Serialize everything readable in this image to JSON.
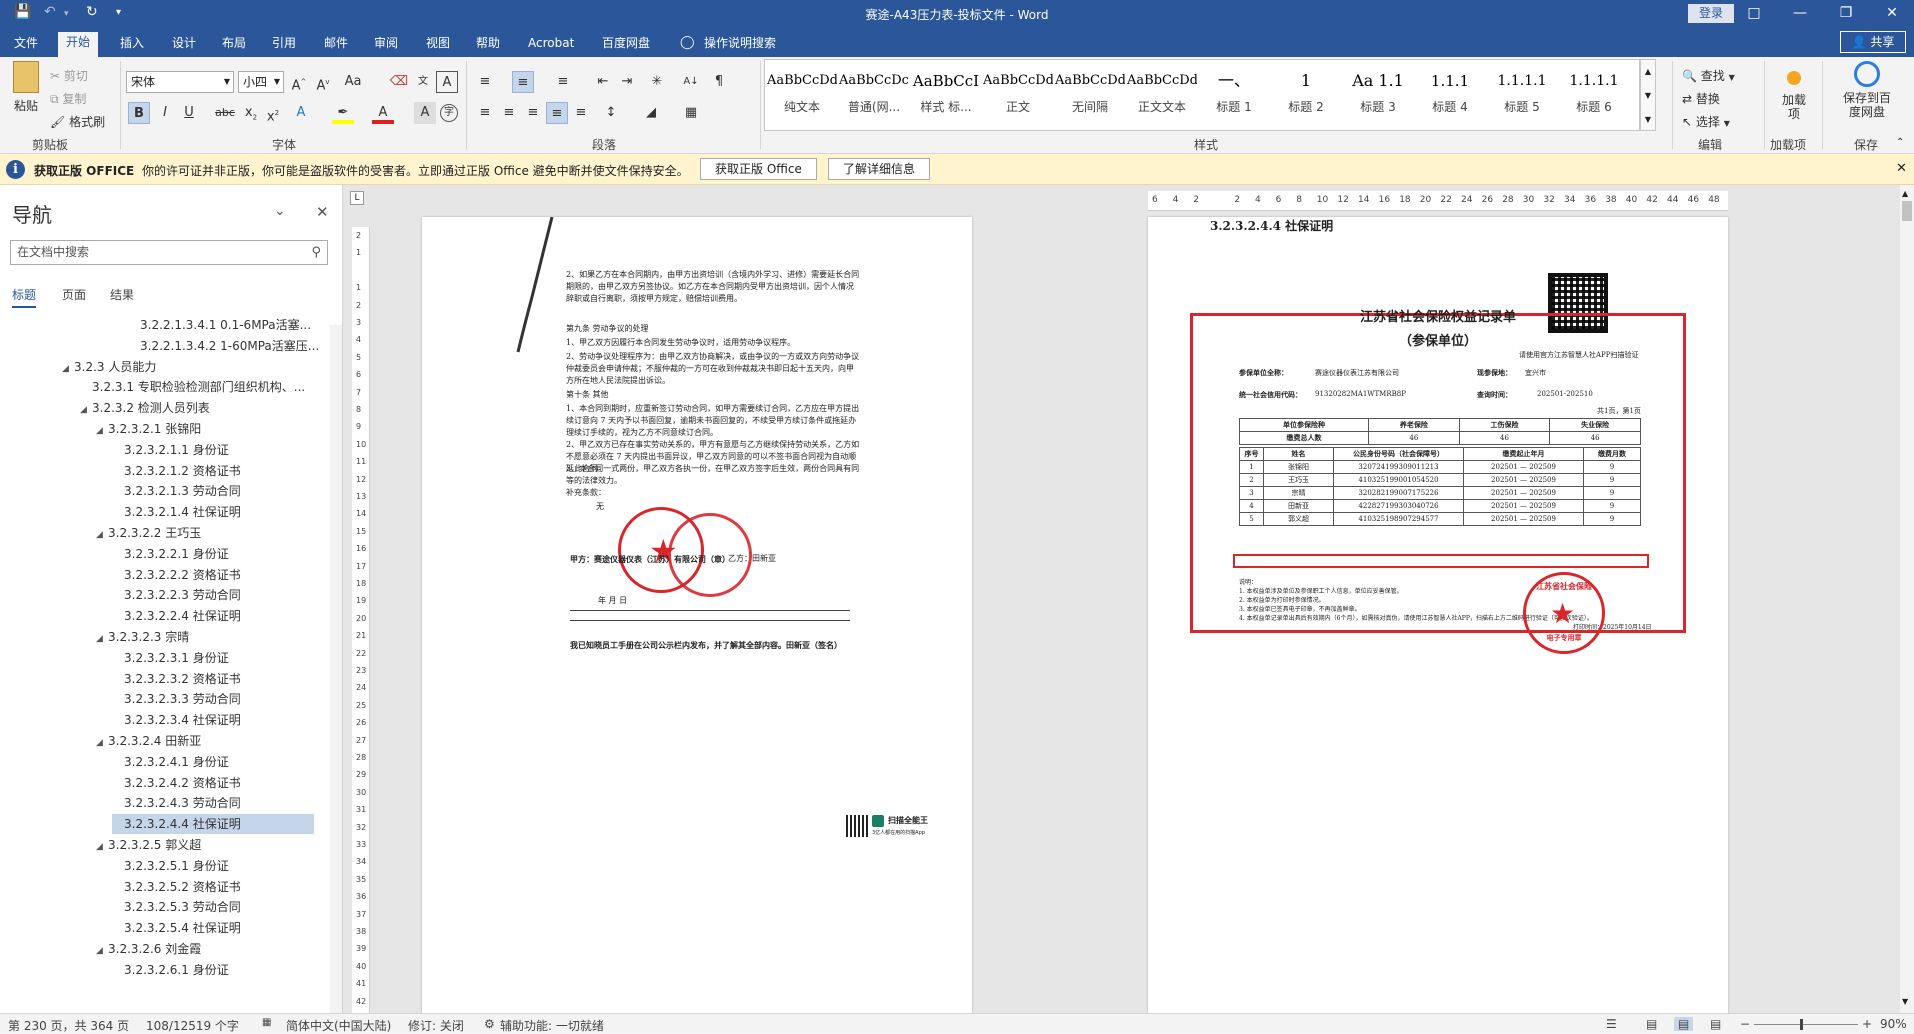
{
  "title_bar": {
    "doc_title": "赛途-A43压力表-投标文件 - Word",
    "login": "登录",
    "share": "共享"
  },
  "tabs": [
    "文件",
    "开始",
    "插入",
    "设计",
    "布局",
    "引用",
    "邮件",
    "审阅",
    "视图",
    "帮助",
    "Acrobat",
    "百度网盘",
    "操作说明搜索"
  ],
  "active_tab": "开始",
  "ribbon": {
    "clipboard": {
      "paste": "粘贴",
      "cut": "剪切",
      "copy": "复制",
      "format_painter": "格式刷",
      "label": "剪贴板"
    },
    "font": {
      "name": "宋体",
      "size": "小四",
      "label": "字体"
    },
    "paragraph": {
      "label": "段落"
    },
    "styles": {
      "label": "样式",
      "items": [
        {
          "preview": "AaBbCcDdI",
          "name": "纯文本"
        },
        {
          "preview": "AaBbCcDc",
          "name": "普通(网..."
        },
        {
          "preview": "AaBbCcI",
          "name": "样式 标..."
        },
        {
          "preview": "AaBbCcDdI",
          "name": "正文"
        },
        {
          "preview": "AaBbCcDdI",
          "name": "无间隔"
        },
        {
          "preview": "AaBbCcDdI",
          "name": "正文文本"
        },
        {
          "preview": "一、",
          "name": "标题 1"
        },
        {
          "preview": "1",
          "name": "标题 2"
        },
        {
          "preview": "Aa 1.1",
          "name": "标题 3"
        },
        {
          "preview": "1.1.1",
          "name": "标题 4"
        },
        {
          "preview": "1.1.1.1",
          "name": "标题 5"
        },
        {
          "preview": "1.1.1.1",
          "name": "标题 6"
        }
      ]
    },
    "editing": {
      "find": "查找",
      "replace": "替换",
      "select": "选择",
      "label": "编辑"
    },
    "addins": {
      "load": "加载项",
      "label": "加载项"
    },
    "save": {
      "baidu": "保存到百度网盘",
      "label": "保存"
    }
  },
  "infobar": {
    "heading": "获取正版 OFFICE",
    "message": "你的许可证并非正版，你可能是盗版软件的受害者。立即通过正版 Office 避免中断并使文件保持安全。",
    "btn_get": "获取正版 Office",
    "btn_learn": "了解详细信息"
  },
  "nav": {
    "title": "导航",
    "search_placeholder": "在文档中搜索",
    "tabs": [
      "标题",
      "页面",
      "结果"
    ],
    "active_tab": "标题",
    "items": [
      {
        "text": "3.2.2.1.3.4.1 0.1-6MPa活塞...",
        "level": 5,
        "expanded": null,
        "selected": false
      },
      {
        "text": "3.2.2.1.3.4.2 1-60MPa活塞压...",
        "level": 5,
        "expanded": null,
        "selected": false
      },
      {
        "text": "3.2.3 人员能力",
        "level": 1,
        "expanded": true,
        "selected": false
      },
      {
        "text": "3.2.3.1 专职检验检测部门组织机构、...",
        "level": 2,
        "expanded": null,
        "selected": false
      },
      {
        "text": "3.2.3.2 检测人员列表",
        "level": 2,
        "expanded": true,
        "selected": false
      },
      {
        "text": "3.2.3.2.1 张锦阳",
        "level": 3,
        "expanded": true,
        "selected": false
      },
      {
        "text": "3.2.3.2.1.1 身份证",
        "level": 4,
        "expanded": null,
        "selected": false
      },
      {
        "text": "3.2.3.2.1.2 资格证书",
        "level": 4,
        "expanded": null,
        "selected": false
      },
      {
        "text": "3.2.3.2.1.3 劳动合同",
        "level": 4,
        "expanded": null,
        "selected": false
      },
      {
        "text": "3.2.3.2.1.4 社保证明",
        "level": 4,
        "expanded": null,
        "selected": false
      },
      {
        "text": "3.2.3.2.2 王巧玉",
        "level": 3,
        "expanded": true,
        "selected": false
      },
      {
        "text": "3.2.3.2.2.1 身份证",
        "level": 4,
        "expanded": null,
        "selected": false
      },
      {
        "text": "3.2.3.2.2.2 资格证书",
        "level": 4,
        "expanded": null,
        "selected": false
      },
      {
        "text": "3.2.3.2.2.3 劳动合同",
        "level": 4,
        "expanded": null,
        "selected": false
      },
      {
        "text": "3.2.3.2.2.4 社保证明",
        "level": 4,
        "expanded": null,
        "selected": false
      },
      {
        "text": "3.2.3.2.3 宗晴",
        "level": 3,
        "expanded": true,
        "selected": false
      },
      {
        "text": "3.2.3.2.3.1 身份证",
        "level": 4,
        "expanded": null,
        "selected": false
      },
      {
        "text": "3.2.3.2.3.2 资格证书",
        "level": 4,
        "expanded": null,
        "selected": false
      },
      {
        "text": "3.2.3.2.3.3 劳动合同",
        "level": 4,
        "expanded": null,
        "selected": false
      },
      {
        "text": "3.2.3.2.3.4 社保证明",
        "level": 4,
        "expanded": null,
        "selected": false
      },
      {
        "text": "3.2.3.2.4 田新亚",
        "level": 3,
        "expanded": true,
        "selected": false
      },
      {
        "text": "3.2.3.2.4.1 身份证",
        "level": 4,
        "expanded": null,
        "selected": false
      },
      {
        "text": "3.2.3.2.4.2 资格证书",
        "level": 4,
        "expanded": null,
        "selected": false
      },
      {
        "text": "3.2.3.2.4.3 劳动合同",
        "level": 4,
        "expanded": null,
        "selected": false
      },
      {
        "text": "3.2.3.2.4.4 社保证明",
        "level": 4,
        "expanded": null,
        "selected": true
      },
      {
        "text": "3.2.3.2.5 郭义超",
        "level": 3,
        "expanded": true,
        "selected": false
      },
      {
        "text": "3.2.3.2.5.1 身份证",
        "level": 4,
        "expanded": null,
        "selected": false
      },
      {
        "text": "3.2.3.2.5.2 资格证书",
        "level": 4,
        "expanded": null,
        "selected": false
      },
      {
        "text": "3.2.3.2.5.3 劳动合同",
        "level": 4,
        "expanded": null,
        "selected": false
      },
      {
        "text": "3.2.3.2.5.4 社保证明",
        "level": 4,
        "expanded": null,
        "selected": false
      },
      {
        "text": "3.2.3.2.6 刘金霞",
        "level": 3,
        "expanded": true,
        "selected": false
      },
      {
        "text": "3.2.3.2.6.1 身份证",
        "level": 4,
        "expanded": null,
        "selected": false
      }
    ]
  },
  "ruler_right": [
    "6",
    "4",
    "2",
    "",
    "2",
    "4",
    "6",
    "8",
    "10",
    "12",
    "14",
    "16",
    "18",
    "20",
    "22",
    "24",
    "26",
    "28",
    "30",
    "32",
    "34",
    "36",
    "38",
    "40",
    "42",
    "44",
    "46",
    "48"
  ],
  "ruler_v": [
    "2",
    "1",
    "",
    "1",
    "2",
    "3",
    "4",
    "5",
    "6",
    "7",
    "8",
    "9",
    "10",
    "11",
    "12",
    "13",
    "14",
    "15",
    "16",
    "17",
    "18",
    "19",
    "20",
    "21",
    "22",
    "23",
    "24",
    "25",
    "26",
    "27",
    "28",
    "29",
    "30",
    "31",
    "32",
    "33",
    "34",
    "35",
    "36",
    "37",
    "38",
    "39",
    "40",
    "41",
    "42"
  ],
  "left_page": {
    "para_2": "2、如果乙方在本合同期内，由甲方出资培训（含境内外学习、进修）需要延长合同期限的，由甲乙双方另签协议。如乙方在本合同期内受甲方出资培训，因个人情况辞职或自行离职，须按甲方规定，赔偿培训费用。",
    "art9_title": "第九条                      劳动争议的处理",
    "art9_1": "1、甲乙双方因履行本合同发生劳动争议时，适用劳动争议程序。",
    "art9_2": "2、劳动争议处理程序为：由甲乙双方协商解决，或由争议的一方或双方向劳动争议仲裁委员会申请仲裁；不服仲裁的一方可在收到仲裁裁决书即日起十五天内，向甲方所在地人民法院提出诉讼。",
    "art10_title": "第十条                          其他",
    "art10_1": "1、本合同到期时，应重新签订劳动合同，如甲方需要续订合同，乙方应在甲方提出续订意向 7 天内予以书面回复，逾期未书面回复的，不续受甲方续订条件或拖延办理续订手续的，视为乙方不同意续订合同。",
    "art10_2": "2、甲乙双方已存在事实劳动关系的，甲方有意愿与乙方继续保持劳动关系，乙方如不愿意必须在 7 天内提出书面异议，甲乙双方同意的可以不签书面合同视为自动顺延此合同。",
    "art10_3": "3、本合同一式两份，甲乙双方各执一份，在甲乙双方签字后生效，两份合同具有同等的法律效力。",
    "supplement": "补充条款：",
    "none": "无",
    "party_a": "甲方：赛途仪器仪表（江苏）有限公司（章）",
    "party_b": "乙方：田新亚",
    "date": "年    月    日",
    "ack": "我已知晓员工手册在公司公示栏内发布，并了解其全部内容。田新亚（签名）",
    "scanner": "扫描全能王",
    "scanner_sub": "3亿人都在用的扫描App"
  },
  "right_page": {
    "heading": "3.2.3.2.4.4   社保证明",
    "cert_title": "江苏省社会保险权益记录单",
    "cert_sub": "（参保单位）",
    "verify": "请使用官方江苏智慧人社APP扫描验证",
    "unit_label": "参保单位全称：",
    "unit_value": "赛途仪器仪表江苏有限公司",
    "place_label": "现参保地：",
    "place_value": "宜兴市",
    "credit_label": "统一社会信用代码：",
    "credit_value": "91320282MA1WTMRB8P",
    "query_label": "查询时间：",
    "query_value": "202501-202510",
    "pages": "共1页，第1页",
    "summary_headers": [
      "单位参保险种",
      "养老保险",
      "工伤保险",
      "失业保险"
    ],
    "summary_values": [
      "缴费总人数",
      "46",
      "46",
      "46"
    ],
    "detail_headers": [
      "序号",
      "姓名",
      "公民身份号码（社会保障号）",
      "缴费起止年月",
      "缴费月数"
    ],
    "rows": [
      [
        "1",
        "张锦阳",
        "320724199309011213",
        "202501 — 202509",
        "9"
      ],
      [
        "2",
        "王巧玉",
        "410325199001054520",
        "202501 — 202509",
        "9"
      ],
      [
        "3",
        "宗晴",
        "320282199007175226",
        "202501 — 202509",
        "9"
      ],
      [
        "4",
        "田新亚",
        "422827199303040726",
        "202501 — 202509",
        "9"
      ],
      [
        "5",
        "郭义超",
        "410325198907294577",
        "202501 — 202509",
        "9"
      ]
    ],
    "notes_title": "说明：",
    "notes": [
      "1. 本权益单涉及单位及参保职工个人信息，单位应妥善保管。",
      "2. 本权益单为打印时参保情况。",
      "3. 本权益单已签具电子印章，不再加盖鲜章。",
      "4. 本权益单记录单出具后有效期内（6个月），如需核对真伪，请使用江苏智慧人社APP，扫描右上方二维码进行验证（可多次验证）。"
    ],
    "seal_text": "江苏省社会保险",
    "seal_bottom": "电子专用章",
    "print_date": "打印时间：2025年10月14日"
  },
  "status": {
    "page": "第 230 页，共 364 页",
    "words": "108/12519 个字",
    "lang": "简体中文(中国大陆)",
    "track": "修订: 关闭",
    "access": "辅助功能: 一切就绪",
    "zoom": "90%"
  },
  "colors": {
    "brand": "#2b579a",
    "highlight_box": "#d8262b",
    "selection": "#c5d5ea",
    "infobar": "#fff4ce"
  }
}
